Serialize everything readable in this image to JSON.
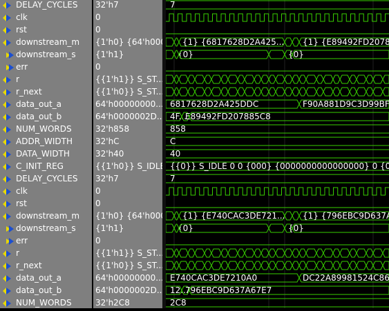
{
  "colors": {
    "wave": "#39d000",
    "background": "#000000",
    "panel": "#7f7f7f",
    "icon_yellow": "#e8d800",
    "icon_blue": "#1c4fd0"
  },
  "signals": [
    {
      "name": "DELAY_CYCLES",
      "value": "32'h7",
      "icon": "input-arrow-icon",
      "wave": {
        "kind": "const",
        "text": "7"
      }
    },
    {
      "name": "clk",
      "value": "0",
      "icon": "input-arrow-icon",
      "wave": {
        "kind": "clock"
      }
    },
    {
      "name": "rst",
      "value": "0",
      "icon": "input-arrow-icon",
      "wave": {
        "kind": "low"
      }
    },
    {
      "name": "downstream_m",
      "value": "{1'h0} {64'h000...",
      "icon": "input-arrow-icon",
      "wave": {
        "kind": "bus",
        "segments": [
          {
            "text": ""
          },
          {
            "text": ""
          },
          {
            "text": "{1} {6817628D2A425..."
          },
          {
            "text": ""
          },
          {
            "text": ""
          },
          {
            "text": "{1} {E89492FD207885"
          }
        ]
      }
    },
    {
      "name": "downstream_s",
      "value": "{1'h1}",
      "icon": "output-arrow-icon",
      "wave": {
        "kind": "bus",
        "segments": [
          {
            "text": ""
          },
          {
            "text": "{0}"
          },
          {
            "text": ""
          },
          {
            "text": ""
          },
          {
            "text": "{0}"
          },
          {
            "text": ""
          }
        ]
      }
    },
    {
      "name": "err",
      "value": "0",
      "icon": "output-arrow-icon",
      "wave": {
        "kind": "low"
      }
    },
    {
      "name": "r",
      "value": "{{1'h1}} S_ST...",
      "icon": "input-arrow-icon",
      "wave": {
        "kind": "dense"
      }
    },
    {
      "name": "r_next",
      "value": "{{1'h0}} S_ST...",
      "icon": "input-arrow-icon",
      "wave": {
        "kind": "dense"
      }
    },
    {
      "name": "data_out_a",
      "value": "64'h00000000...",
      "icon": "input-arrow-icon",
      "wave": {
        "kind": "bus",
        "segments": [
          {
            "text": "6817628D2A425DDC"
          },
          {
            "text": "F90A881D9C3D99BF"
          }
        ]
      }
    },
    {
      "name": "data_out_b",
      "value": "64'h0000002D...",
      "icon": "input-arrow-icon",
      "wave": {
        "kind": "bus",
        "segments": [
          {
            "text": "4F..."
          },
          {
            "text": "E89492FD207885C8"
          }
        ]
      }
    },
    {
      "name": "NUM_WORDS",
      "value": "32'h858",
      "icon": "input-arrow-icon",
      "wave": {
        "kind": "const",
        "text": "858"
      }
    },
    {
      "name": "ADDR_WIDTH",
      "value": "32'hC",
      "icon": "input-arrow-icon",
      "wave": {
        "kind": "const",
        "text": "C"
      }
    },
    {
      "name": "DATA_WIDTH",
      "value": "32'h40",
      "icon": "input-arrow-icon",
      "wave": {
        "kind": "const",
        "text": "40"
      }
    },
    {
      "name": "C_INIT_REG",
      "value": "{{1'h0}} S_IDLE...",
      "icon": "input-arrow-icon",
      "wave": {
        "kind": "const",
        "text": "{{0}} S_IDLE 0 0 {000} {0000000000000000} 0 {000} {0000"
      }
    },
    {
      "name": "DELAY_CYCLES",
      "value": "32'h7",
      "icon": "input-arrow-icon",
      "wave": {
        "kind": "const",
        "text": "7"
      }
    },
    {
      "name": "clk",
      "value": "0",
      "icon": "input-arrow-icon",
      "wave": {
        "kind": "clock"
      }
    },
    {
      "name": "rst",
      "value": "0",
      "icon": "input-arrow-icon",
      "wave": {
        "kind": "low"
      }
    },
    {
      "name": "downstream_m",
      "value": "{1'h0} {64'h000...",
      "icon": "input-arrow-icon",
      "wave": {
        "kind": "bus",
        "segments": [
          {
            "text": ""
          },
          {
            "text": ""
          },
          {
            "text": "{1} {E740CAC3DE721..."
          },
          {
            "text": ""
          },
          {
            "text": ""
          },
          {
            "text": "{1} {796EBC9D637A6"
          }
        ]
      }
    },
    {
      "name": "downstream_s",
      "value": "{1'h1}",
      "icon": "output-arrow-icon",
      "wave": {
        "kind": "bus",
        "segments": [
          {
            "text": ""
          },
          {
            "text": "{0}"
          },
          {
            "text": ""
          },
          {
            "text": ""
          },
          {
            "text": "{0}"
          },
          {
            "text": ""
          }
        ]
      }
    },
    {
      "name": "err",
      "value": "0",
      "icon": "output-arrow-icon",
      "wave": {
        "kind": "low"
      }
    },
    {
      "name": "r",
      "value": "{{1'h1}} S_ST...",
      "icon": "input-arrow-icon",
      "wave": {
        "kind": "dense"
      }
    },
    {
      "name": "r_next",
      "value": "{{1'h0}} S_ST...",
      "icon": "input-arrow-icon",
      "wave": {
        "kind": "dense"
      }
    },
    {
      "name": "data_out_a",
      "value": "64'h00000000...",
      "icon": "input-arrow-icon",
      "wave": {
        "kind": "bus",
        "segments": [
          {
            "text": "E740CAC3DE7210A0"
          },
          {
            "text": "DC22A89981524C86"
          }
        ]
      }
    },
    {
      "name": "data_out_b",
      "value": "64'h0000002D...",
      "icon": "input-arrow-icon",
      "wave": {
        "kind": "bus",
        "segments": [
          {
            "text": "12..."
          },
          {
            "text": "796EBC9D637A67E7"
          }
        ]
      }
    },
    {
      "name": "NUM_WORDS",
      "value": "32'h2C8",
      "icon": "input-arrow-icon",
      "wave": {
        "kind": "const",
        "text": "2C8"
      }
    }
  ]
}
